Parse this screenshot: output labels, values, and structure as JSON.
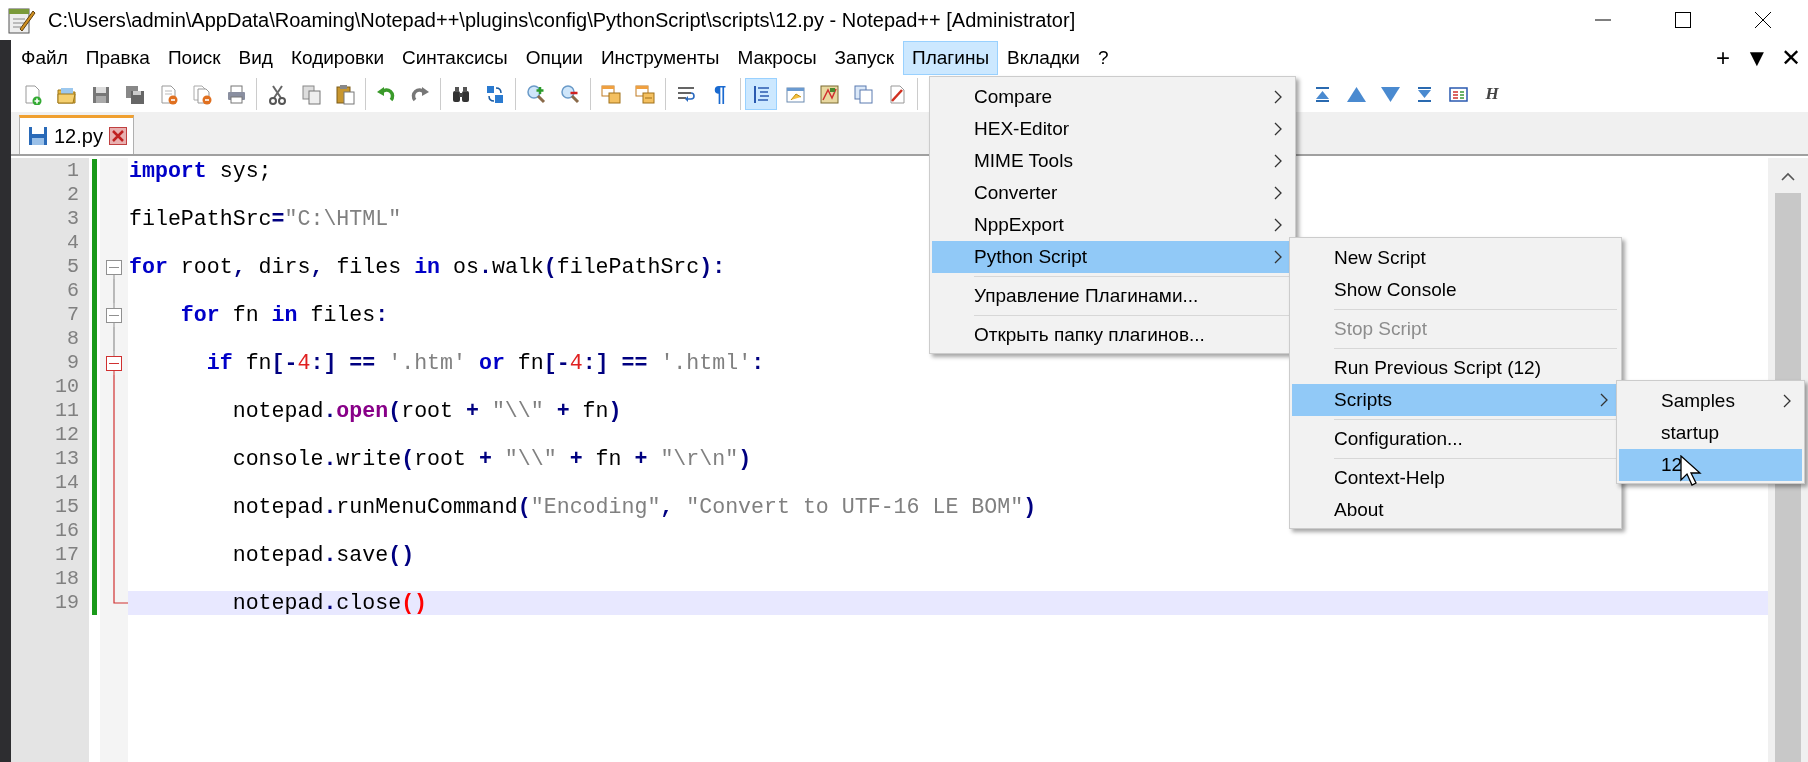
{
  "window": {
    "title": "C:\\Users\\admin\\AppData\\Roaming\\Notepad++\\plugins\\config\\PythonScript\\scripts\\12.py - Notepad++ [Administrator]"
  },
  "menu_bar": {
    "items": [
      {
        "label": "Файл",
        "selected": false
      },
      {
        "label": "Правка",
        "selected": false
      },
      {
        "label": "Поиск",
        "selected": false
      },
      {
        "label": "Вид",
        "selected": false
      },
      {
        "label": "Кодировки",
        "selected": false
      },
      {
        "label": "Синтаксисы",
        "selected": false
      },
      {
        "label": "Опции",
        "selected": false
      },
      {
        "label": "Инструменты",
        "selected": false
      },
      {
        "label": "Макросы",
        "selected": false
      },
      {
        "label": "Запуск",
        "selected": false
      },
      {
        "label": "Плагины",
        "selected": true
      },
      {
        "label": "Вкладки",
        "selected": false
      },
      {
        "label": "?",
        "selected": false
      }
    ],
    "right_buttons": [
      "+",
      "▼",
      "✕"
    ]
  },
  "toolbar": {
    "groups": [
      {
        "buttons": [
          {
            "pressed": false
          },
          {
            "pressed": false
          },
          {
            "pressed": false
          },
          {
            "pressed": false
          },
          {
            "pressed": false
          },
          {
            "pressed": false
          },
          {
            "pressed": false
          }
        ]
      },
      {
        "buttons": [
          {
            "pressed": false
          },
          {
            "pressed": false
          },
          {
            "pressed": false
          }
        ]
      },
      {
        "buttons": [
          {
            "pressed": false
          },
          {
            "pressed": false
          }
        ]
      },
      {
        "buttons": [
          {
            "pressed": false
          },
          {
            "pressed": false
          }
        ]
      },
      {
        "buttons": [
          {
            "pressed": false
          },
          {
            "pressed": false
          }
        ]
      },
      {
        "buttons": [
          {
            "pressed": false
          },
          {
            "pressed": false
          }
        ]
      },
      {
        "buttons": [
          {
            "pressed": false
          },
          {
            "glyph": "¶",
            "pressed": false
          }
        ]
      },
      {
        "buttons": [
          {
            "pressed": true
          },
          {
            "pressed": false
          },
          {
            "pressed": false
          },
          {
            "pressed": false
          },
          {
            "pressed": false
          }
        ]
      },
      {
        "buttons": [
          {
            "pressed": false
          },
          {
            "pressed": false
          },
          {
            "pressed": false
          },
          {
            "pressed": false
          },
          {
            "pressed": false
          },
          {
            "glyph": "H",
            "pressed": false
          }
        ]
      }
    ]
  },
  "tabs": [
    {
      "label": "12.py",
      "selected": true
    }
  ],
  "editor": {
    "lines": [
      {
        "number": "1",
        "modified": true,
        "current": false,
        "tokens": [
          {
            "kind": "keyword",
            "text": "import"
          },
          {
            "kind": "plain",
            "text": " sys;"
          }
        ]
      },
      {
        "number": "2",
        "modified": true,
        "current": false
      },
      {
        "number": "3",
        "modified": true,
        "current": false,
        "tokens": [
          {
            "kind": "plain",
            "text": "filePathSrc"
          },
          {
            "kind": "operator",
            "text": "="
          },
          {
            "kind": "string",
            "text": "\"C:\\HTML\""
          }
        ]
      },
      {
        "number": "4",
        "modified": true,
        "current": false
      },
      {
        "number": "5",
        "modified": true,
        "current": false,
        "fold": {
          "kind": "header",
          "current": false
        },
        "tokens": [
          {
            "kind": "keyword",
            "text": "for"
          },
          {
            "kind": "plain",
            "text": " root"
          },
          {
            "kind": "operator",
            "text": ","
          },
          {
            "kind": "plain",
            "text": " dirs"
          },
          {
            "kind": "operator",
            "text": ","
          },
          {
            "kind": "plain",
            "text": " files "
          },
          {
            "kind": "keyword",
            "text": "in"
          },
          {
            "kind": "plain",
            "text": " os"
          },
          {
            "kind": "operator",
            "text": "."
          },
          {
            "kind": "plain",
            "text": "walk"
          },
          {
            "kind": "operator",
            "text": "("
          },
          {
            "kind": "plain",
            "text": "filePathSrc"
          },
          {
            "kind": "operator",
            "text": "):"
          }
        ]
      },
      {
        "number": "6",
        "modified": true,
        "current": false,
        "fold": {
          "kind": "body",
          "current": false
        }
      },
      {
        "number": "7",
        "modified": true,
        "current": false,
        "fold": {
          "kind": "header",
          "current": false
        },
        "tokens": [
          {
            "kind": "keyword",
            "text": "    for"
          },
          {
            "kind": "plain",
            "text": " fn "
          },
          {
            "kind": "keyword",
            "text": "in"
          },
          {
            "kind": "plain",
            "text": " files"
          },
          {
            "kind": "operator",
            "text": ":"
          }
        ]
      },
      {
        "number": "8",
        "modified": true,
        "current": false,
        "fold": {
          "kind": "body",
          "current": false
        }
      },
      {
        "number": "9",
        "modified": true,
        "current": false,
        "fold": {
          "kind": "header",
          "current": true
        },
        "tokens": [
          {
            "kind": "keyword",
            "text": "      if"
          },
          {
            "kind": "plain",
            "text": " fn"
          },
          {
            "kind": "operator",
            "text": "[-"
          },
          {
            "kind": "number",
            "text": "4"
          },
          {
            "kind": "operator",
            "text": ":] == "
          },
          {
            "kind": "string",
            "text": "'.htm' "
          },
          {
            "kind": "keyword",
            "text": "or"
          },
          {
            "kind": "plain",
            "text": " fn"
          },
          {
            "kind": "operator",
            "text": "[-"
          },
          {
            "kind": "number",
            "text": "4"
          },
          {
            "kind": "operator",
            "text": ":] == "
          },
          {
            "kind": "string",
            "text": "'.html'"
          },
          {
            "kind": "operator",
            "text": ":"
          }
        ]
      },
      {
        "number": "10",
        "modified": true,
        "current": false,
        "fold": {
          "kind": "body",
          "current": true
        }
      },
      {
        "number": "11",
        "modified": true,
        "current": false,
        "fold": {
          "kind": "body",
          "current": true
        },
        "tokens": [
          {
            "kind": "plain",
            "text": "        notepad"
          },
          {
            "kind": "operator",
            "text": "."
          },
          {
            "kind": "builtin",
            "text": "open"
          },
          {
            "kind": "operator",
            "text": "("
          },
          {
            "kind": "plain",
            "text": "root "
          },
          {
            "kind": "operator",
            "text": "+ "
          },
          {
            "kind": "string",
            "text": "\"\\\\\" "
          },
          {
            "kind": "operator",
            "text": "+"
          },
          {
            "kind": "plain",
            "text": " fn"
          },
          {
            "kind": "operator",
            "text": ")"
          }
        ]
      },
      {
        "number": "12",
        "modified": true,
        "current": false,
        "fold": {
          "kind": "body",
          "current": true
        }
      },
      {
        "number": "13",
        "modified": true,
        "current": false,
        "fold": {
          "kind": "body",
          "current": true
        },
        "tokens": [
          {
            "kind": "plain",
            "text": "        console"
          },
          {
            "kind": "operator",
            "text": "."
          },
          {
            "kind": "plain",
            "text": "write"
          },
          {
            "kind": "operator",
            "text": "("
          },
          {
            "kind": "plain",
            "text": "root "
          },
          {
            "kind": "operator",
            "text": "+ "
          },
          {
            "kind": "string",
            "text": "\"\\\\\" "
          },
          {
            "kind": "operator",
            "text": "+"
          },
          {
            "kind": "plain",
            "text": " fn "
          },
          {
            "kind": "operator",
            "text": "+ "
          },
          {
            "kind": "string",
            "text": "\"\\r\\n\""
          },
          {
            "kind": "operator",
            "text": ")"
          }
        ]
      },
      {
        "number": "14",
        "modified": true,
        "current": false,
        "fold": {
          "kind": "body",
          "current": true
        }
      },
      {
        "number": "15",
        "modified": true,
        "current": false,
        "fold": {
          "kind": "body",
          "current": true
        },
        "tokens": [
          {
            "kind": "plain",
            "text": "        notepad"
          },
          {
            "kind": "operator",
            "text": "."
          },
          {
            "kind": "plain",
            "text": "runMenuCommand"
          },
          {
            "kind": "operator",
            "text": "("
          },
          {
            "kind": "string",
            "text": "\"Encoding\""
          },
          {
            "kind": "operator",
            "text": ", "
          },
          {
            "kind": "string",
            "text": "\"Convert to UTF-16 LE BOM\""
          },
          {
            "kind": "operator",
            "text": ")"
          }
        ]
      },
      {
        "number": "16",
        "modified": true,
        "current": false,
        "fold": {
          "kind": "body",
          "current": true
        }
      },
      {
        "number": "17",
        "modified": true,
        "current": false,
        "fold": {
          "kind": "body",
          "current": true
        },
        "tokens": [
          {
            "kind": "plain",
            "text": "        notepad"
          },
          {
            "kind": "operator",
            "text": "."
          },
          {
            "kind": "plain",
            "text": "save"
          },
          {
            "kind": "operator",
            "text": "()"
          }
        ]
      },
      {
        "number": "18",
        "modified": true,
        "current": false,
        "fold": {
          "kind": "body",
          "current": true
        }
      },
      {
        "number": "19",
        "modified": true,
        "current": true,
        "fold": {
          "kind": "end",
          "current": true
        },
        "tokens": [
          {
            "kind": "plain",
            "text": "        notepad"
          },
          {
            "kind": "operator",
            "text": "."
          },
          {
            "kind": "plain",
            "text": "close"
          },
          {
            "kind": "brace",
            "text": "()"
          }
        ]
      }
    ]
  },
  "menus": [
    {
      "items": [
        {
          "kind": "item",
          "label": "Compare",
          "submenu": true,
          "selected": false,
          "disabled": false
        },
        {
          "kind": "item",
          "label": "HEX-Editor",
          "submenu": true,
          "selected": false,
          "disabled": false
        },
        {
          "kind": "item",
          "label": "MIME Tools",
          "submenu": true,
          "selected": false,
          "disabled": false
        },
        {
          "kind": "item",
          "label": "Converter",
          "submenu": true,
          "selected": false,
          "disabled": false
        },
        {
          "kind": "item",
          "label": "NppExport",
          "submenu": true,
          "selected": false,
          "disabled": false
        },
        {
          "kind": "item",
          "label": "Python Script",
          "submenu": true,
          "selected": true,
          "disabled": false
        },
        {
          "kind": "separator"
        },
        {
          "kind": "item",
          "label": "Управление Плагинами...",
          "submenu": false,
          "selected": false,
          "disabled": false
        },
        {
          "kind": "separator"
        },
        {
          "kind": "item",
          "label": "Открыть папку плагинов...",
          "submenu": false,
          "selected": false,
          "disabled": false
        }
      ]
    },
    {
      "items": [
        {
          "kind": "item",
          "label": "New Script",
          "submenu": false,
          "selected": false,
          "disabled": false
        },
        {
          "kind": "item",
          "label": "Show Console",
          "submenu": false,
          "selected": false,
          "disabled": false
        },
        {
          "kind": "separator"
        },
        {
          "kind": "item",
          "label": "Stop Script",
          "submenu": false,
          "selected": false,
          "disabled": true
        },
        {
          "kind": "separator"
        },
        {
          "kind": "item",
          "label": "Run Previous Script (12)",
          "submenu": false,
          "selected": false,
          "disabled": false
        },
        {
          "kind": "item",
          "label": "Scripts",
          "submenu": true,
          "selected": true,
          "disabled": false
        },
        {
          "kind": "separator"
        },
        {
          "kind": "item",
          "label": "Configuration...",
          "submenu": false,
          "selected": false,
          "disabled": false
        },
        {
          "kind": "separator"
        },
        {
          "kind": "item",
          "label": "Context-Help",
          "submenu": false,
          "selected": false,
          "disabled": false
        },
        {
          "kind": "item",
          "label": "About",
          "submenu": false,
          "selected": false,
          "disabled": false
        }
      ]
    },
    {
      "items": [
        {
          "kind": "item",
          "label": "Samples",
          "submenu": true,
          "selected": false,
          "disabled": false
        },
        {
          "kind": "item",
          "label": "startup",
          "submenu": false,
          "selected": false,
          "disabled": false
        },
        {
          "kind": "item",
          "label": "12",
          "submenu": false,
          "selected": true,
          "disabled": false
        }
      ]
    }
  ]
}
